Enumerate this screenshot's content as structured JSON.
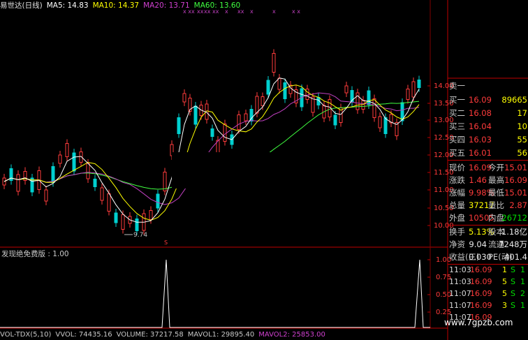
{
  "header": {
    "title": "易世达(日线)",
    "ma5": "MA5: 14.83",
    "ma10": "MA10: 14.37",
    "ma20": "MA20: 13.71",
    "ma60": "MA60: 13.60",
    "colors": {
      "ma5": "#ffffff",
      "ma10": "#ffff00",
      "ma20": "#d040d0",
      "ma60": "#40ff40"
    }
  },
  "price_axis": {
    "labels": [
      "14.00",
      "13.50",
      "13.00",
      "12.50",
      "12.00",
      "11.50",
      "11.00",
      "10.50",
      "10.00"
    ]
  },
  "low_marker": "9.74",
  "indicator": {
    "title": "发现绝免费版 : 1.00",
    "axis_labels": [
      "1.00",
      "0.75",
      "0.50",
      "0.25"
    ]
  },
  "quote": {
    "rows": [
      {
        "label": "卖一",
        "value": "",
        "vol": ""
      },
      {
        "label": "买一",
        "value": "16.09",
        "vol": "89665"
      },
      {
        "label": "买二",
        "value": "16.08",
        "vol": "17"
      },
      {
        "label": "买三",
        "value": "16.04",
        "vol": "10"
      },
      {
        "label": "买四",
        "value": "16.03",
        "vol": "55"
      },
      {
        "label": "买五",
        "value": "16.01",
        "vol": "56"
      }
    ],
    "stats": [
      {
        "l1": "现价",
        "v1": "16.09",
        "l2": "今开",
        "v2": "15.01"
      },
      {
        "l1": "涨跌",
        "v1": "1.46",
        "l2": "最高",
        "v2": "16.09"
      },
      {
        "l1": "涨幅",
        "v1": "9.98%",
        "l2": "最低",
        "v2": "15.01"
      },
      {
        "l1": "总量",
        "v1": "37217",
        "l2": "量比",
        "v2": "2.87"
      },
      {
        "l1": "外盘",
        "v1": "10505",
        "l2": "内盘",
        "v2": "26712"
      }
    ],
    "stats2": [
      {
        "l1": "换手",
        "v1": "5.13%",
        "l2": "股本",
        "v2": "1.18亿"
      },
      {
        "l1": "净资",
        "v1": "9.04",
        "l2": "流通",
        "v2": "7248万"
      },
      {
        "l1": "收益(三)",
        "v1": "0.030",
        "l2": "PE(动)",
        "v2": "401.4"
      }
    ],
    "ticks": [
      {
        "time": "11:03",
        "price": "16.09",
        "vol": "1",
        "side": "S",
        "n": "1"
      },
      {
        "time": "11:03",
        "price": "16.09",
        "vol": "5",
        "side": "S",
        "n": "1"
      },
      {
        "time": "11:07",
        "price": "16.09",
        "vol": "5",
        "side": "S",
        "n": "2"
      },
      {
        "time": "11:07",
        "price": "16.09",
        "vol": "3",
        "side": "S",
        "n": "1"
      },
      {
        "time": "11:07",
        "price": "16.09",
        "vol": "",
        "side": "",
        "n": ""
      }
    ]
  },
  "footer": {
    "name": "VOL-TDX(5,10)",
    "vvol": "VVOL: 74435.16",
    "volume": "VOLUME: 37217.58",
    "mavol1": "MAVOL1: 29895.40",
    "mavol2": "MAVOL2: 25853.00"
  },
  "watermark": "www.7gpzb.com"
}
